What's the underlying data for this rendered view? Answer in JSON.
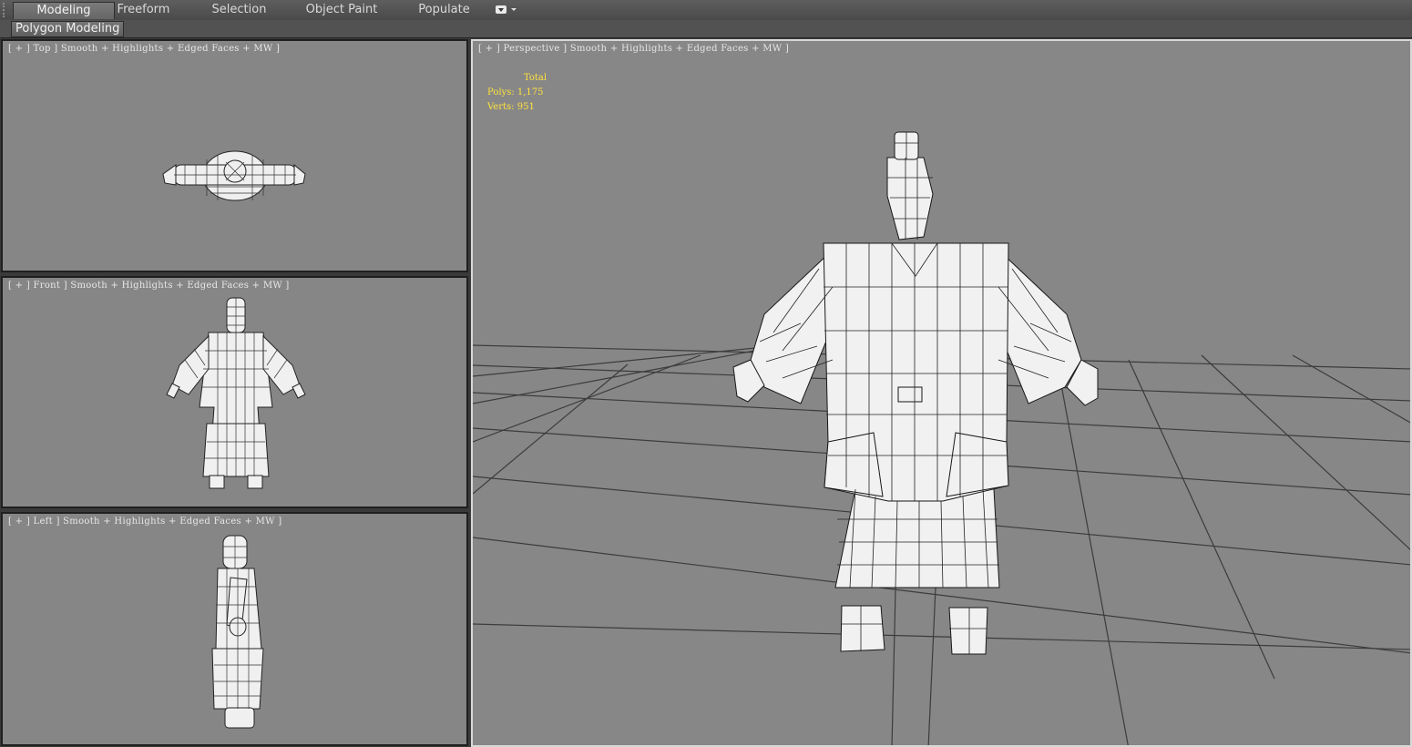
{
  "ribbon": {
    "tabs": [
      {
        "label": "Modeling",
        "active": true
      },
      {
        "label": "Freeform",
        "active": false
      },
      {
        "label": "Selection",
        "active": false
      },
      {
        "label": "Object Paint",
        "active": false
      },
      {
        "label": "Populate",
        "active": false
      }
    ],
    "options_icon": "ribbon-options-icon"
  },
  "subbar": {
    "label": "Polygon Modeling"
  },
  "viewports": {
    "top": {
      "label": "[ + ] Top ] Smooth + Highlights + Edged Faces + MW ]"
    },
    "front": {
      "label": "[ + ] Front ] Smooth + Highlights + Edged Faces + MW ]"
    },
    "left": {
      "label": "[ + ] Left ] Smooth + Highlights + Edged Faces + MW ]"
    },
    "perspective": {
      "label": "[ + ] Perspective ] Smooth + Highlights + Edged Faces + MW ]"
    }
  },
  "stats": {
    "header": "Total",
    "polys_label": "Polys:",
    "polys": "1,175",
    "verts_label": "Verts:",
    "verts": "951"
  },
  "colors": {
    "stats": "#ffe23d",
    "viewport_bg": "#878787",
    "active_border": "#d8d8d8"
  }
}
